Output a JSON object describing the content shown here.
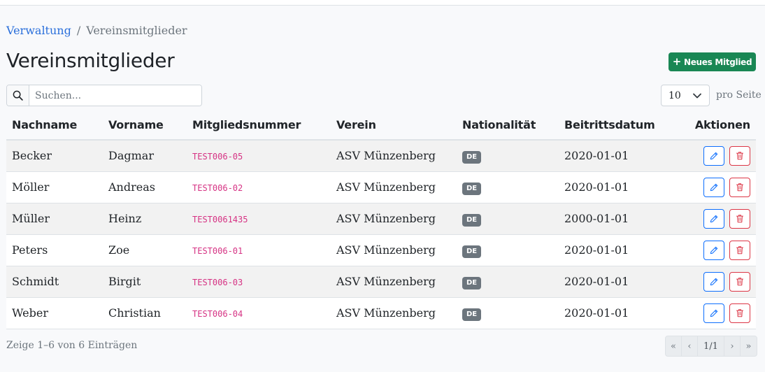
{
  "breadcrumb": {
    "parent": "Verwaltung",
    "separator": "/",
    "current": "Vereinsmitglieder"
  },
  "page_title": "Vereinsmitglieder",
  "new_button": {
    "icon": "+",
    "label": "Neues Mitglied"
  },
  "search": {
    "placeholder": "Suchen...",
    "value": ""
  },
  "per_page": {
    "value": "10",
    "label": "pro Seite"
  },
  "table": {
    "headers": [
      "Nachname",
      "Vorname",
      "Mitgliedsnummer",
      "Verein",
      "Nationalität",
      "Beitrittsdatum",
      "Aktionen"
    ],
    "rows": [
      {
        "nachname": "Becker",
        "vorname": "Dagmar",
        "nummer": "TEST006-05",
        "verein": "ASV Münzenberg",
        "nationalitaet": "DE",
        "datum": "2020-01-01"
      },
      {
        "nachname": "Möller",
        "vorname": "Andreas",
        "nummer": "TEST006-02",
        "verein": "ASV Münzenberg",
        "nationalitaet": "DE",
        "datum": "2020-01-01"
      },
      {
        "nachname": "Müller",
        "vorname": "Heinz",
        "nummer": "TEST0061435",
        "verein": "ASV Münzenberg",
        "nationalitaet": "DE",
        "datum": "2000-01-01"
      },
      {
        "nachname": "Peters",
        "vorname": "Zoe",
        "nummer": "TEST006-01",
        "verein": "ASV Münzenberg",
        "nationalitaet": "DE",
        "datum": "2020-01-01"
      },
      {
        "nachname": "Schmidt",
        "vorname": "Birgit",
        "nummer": "TEST006-03",
        "verein": "ASV Münzenberg",
        "nationalitaet": "DE",
        "datum": "2020-01-01"
      },
      {
        "nachname": "Weber",
        "vorname": "Christian",
        "nummer": "TEST006-04",
        "verein": "ASV Münzenberg",
        "nationalitaet": "DE",
        "datum": "2020-01-01"
      }
    ]
  },
  "footer": {
    "info": "Zeige 1–6 von 6 Einträgen"
  },
  "pagination": {
    "first": "«",
    "prev": "‹",
    "current": "1/1",
    "next": "›",
    "last": "»"
  },
  "colors": {
    "primary": "#0d6efd",
    "success": "#198754",
    "danger": "#dc3545",
    "link": "#2a6fdb",
    "code": "#d63384",
    "badge": "#6c757d"
  }
}
